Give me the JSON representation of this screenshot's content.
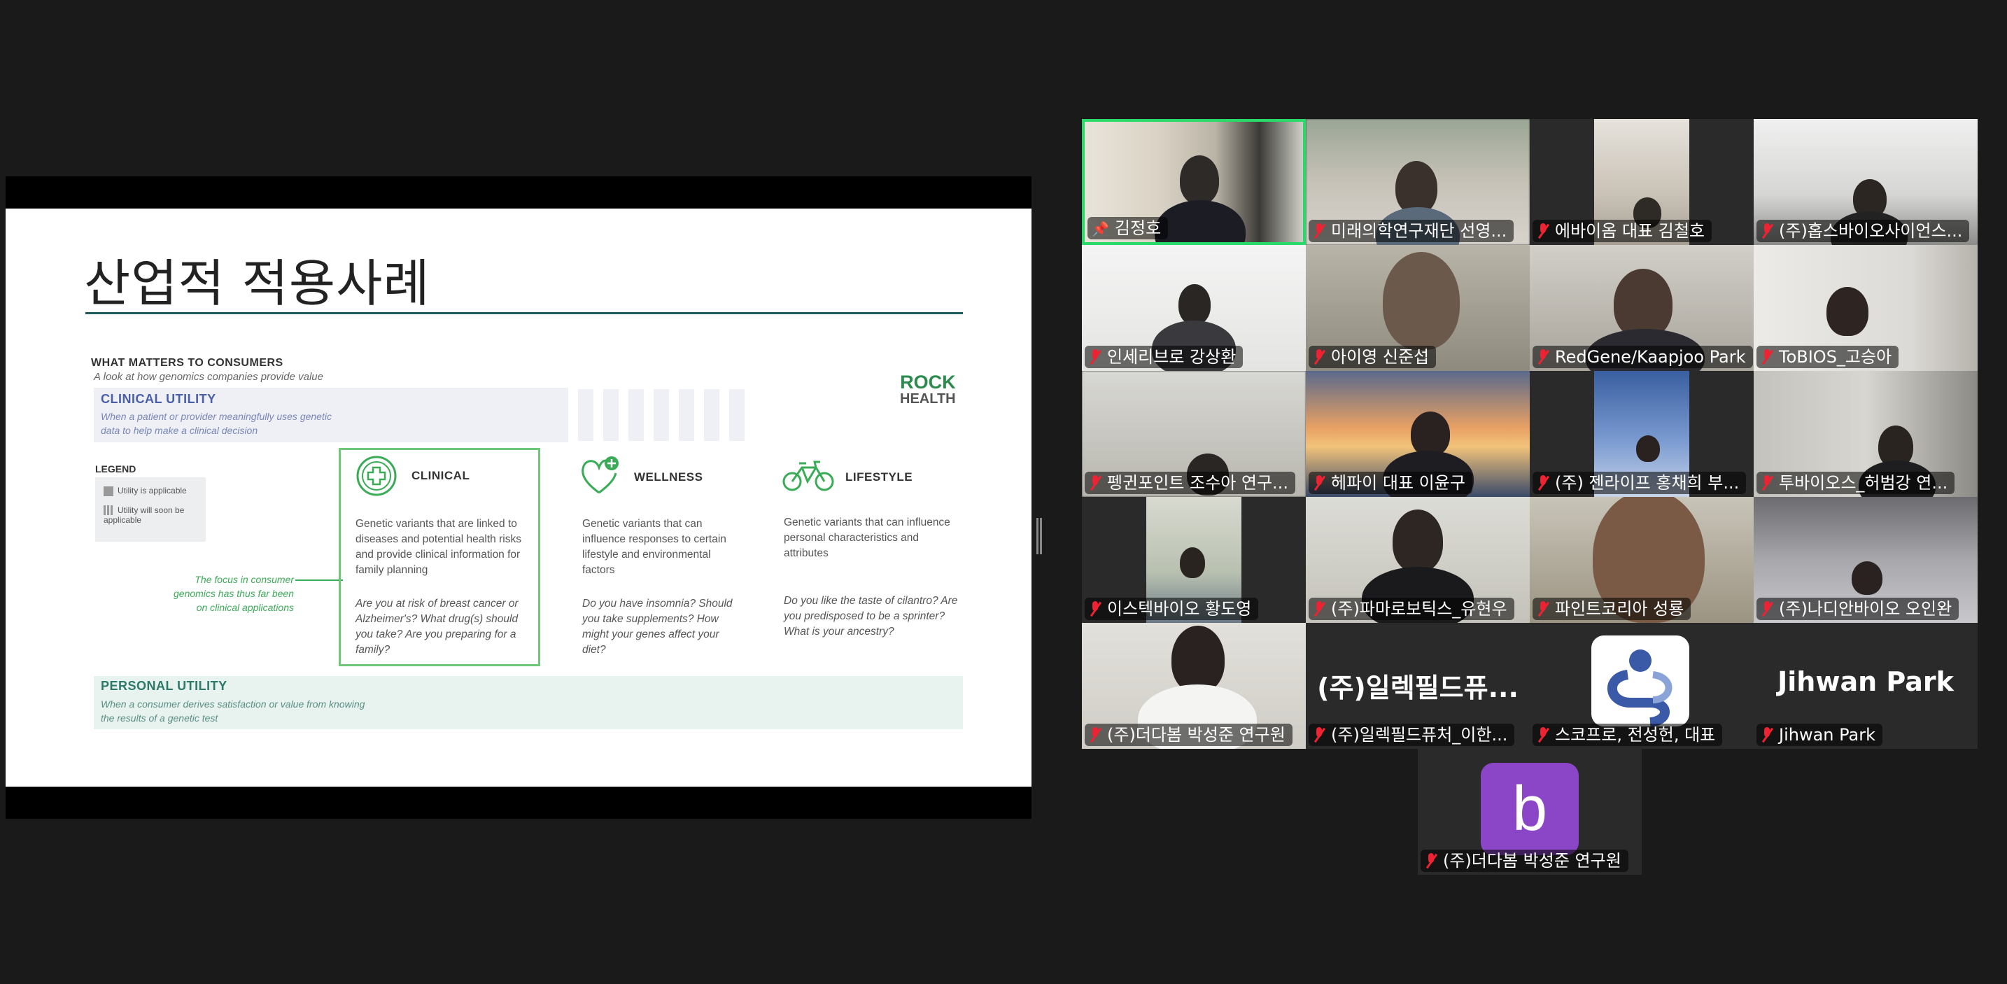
{
  "slide": {
    "title": "산업적 적용사례",
    "header": "WHAT MATTERS TO CONSUMERS",
    "subheader": "A look at how genomics companies provide value",
    "clinical_utility": {
      "title": "CLINICAL UTILITY",
      "desc": "When a patient or provider meaningfully uses genetic data to help make a clinical decision"
    },
    "logo": {
      "line1": "ROCK",
      "line2": "HEALTH"
    },
    "legend": {
      "label": "LEGEND",
      "item1": "Utility is applicable",
      "item2": "Utility will soon be applicable"
    },
    "focus_note": "The focus in consumer genomics has thus far been on clinical applications",
    "columns": [
      {
        "title": "CLINICAL",
        "icon": "medical-cross-icon",
        "text": "Genetic variants that are linked to diseases and potential health risks and provide clinical information for family planning",
        "questions": "Are you at risk of breast cancer or Alzheimer's? What drug(s) should you take? Are you preparing for a family?"
      },
      {
        "title": "WELLNESS",
        "icon": "heart-plus-icon",
        "text": "Genetic variants that can influence responses to certain lifestyle and environmental factors",
        "questions": "Do you have insomnia? Should you take supplements? How might your genes affect your diet?"
      },
      {
        "title": "LIFESTYLE",
        "icon": "bicycle-icon",
        "text": "Genetic variants that can influence personal characteristics and attributes",
        "questions": "Do you like the taste of cilantro? Are you predisposed to be a sprinter? What is your ancestry?"
      }
    ],
    "personal_utility": {
      "title": "PERSONAL UTILITY",
      "desc": "When a consumer derives satisfaction or value from knowing the results of a genetic test"
    }
  },
  "participants": [
    {
      "name": "김정호",
      "pinned": true,
      "muted": false
    },
    {
      "name": "미래의학연구재단 선영...",
      "muted": true
    },
    {
      "name": "에바이옴 대표 김철호",
      "muted": true
    },
    {
      "name": "(주)홉스바이오사이언스...",
      "muted": true
    },
    {
      "name": "인세리브로 강상환",
      "muted": true
    },
    {
      "name": "아이영 신준섭",
      "muted": true
    },
    {
      "name": "RedGene/Kaapjoo Park",
      "muted": true
    },
    {
      "name": "ToBIOS_고승아",
      "muted": true
    },
    {
      "name": "펭귄포인트 조수아 연구...",
      "muted": true
    },
    {
      "name": "헤파이 대표 이윤구",
      "muted": true
    },
    {
      "name": "(주) 젠라이프 홍채희 부...",
      "muted": true
    },
    {
      "name": "투바이오스_허범강 연...",
      "muted": true
    },
    {
      "name": "이스텍바이오 황도영",
      "muted": true
    },
    {
      "name": "(주)파마로보틱스_유현우",
      "muted": true
    },
    {
      "name": "파인트코리아 성룡",
      "muted": true
    },
    {
      "name": "(주)나디안바이오 오인완",
      "muted": true
    },
    {
      "name": "(주)더다봄 박성준 연구원",
      "muted": true
    },
    {
      "name": "(주)일렉필드퓨처_이한...",
      "muted": true,
      "video_off_text": "(주)일렉필드퓨..."
    },
    {
      "name": "스코프로, 전성헌, 대표",
      "muted": true
    },
    {
      "name": "Jihwan Park",
      "muted": true,
      "video_off_text": "Jihwan Park"
    },
    {
      "name": "(주)더다봄 박성준 연구원",
      "muted": true,
      "avatar_letter": "b"
    }
  ],
  "colors": {
    "active_speaker_border": "#2bd96b",
    "mute_icon": "#ee2233",
    "avatar_purple": "#8a46c6"
  }
}
